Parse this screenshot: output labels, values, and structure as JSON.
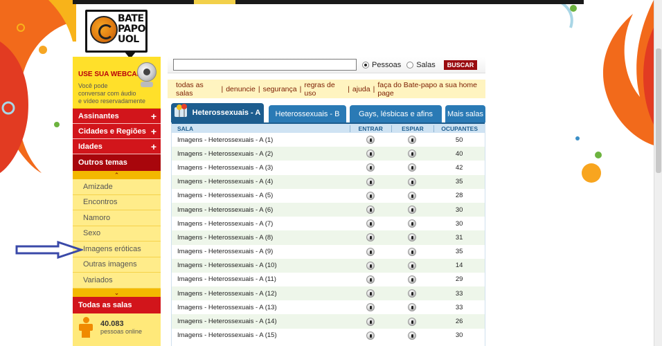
{
  "logo": {
    "line1": "BATE",
    "line2": "PAPO",
    "line3": "UOL"
  },
  "sidebar": {
    "webcam": {
      "title": "USE SUA WEBCAM!",
      "desc1": "Você pode",
      "desc2": "conversar com áudio",
      "desc3": "e vídeo reservadamente"
    },
    "sections": [
      {
        "label": "Assinantes",
        "expand": "+"
      },
      {
        "label": "Cidades e Regiões",
        "expand": "+"
      },
      {
        "label": "Idades",
        "expand": "+"
      }
    ],
    "outros_label": "Outros temas",
    "collapse_glyph": "⌃",
    "expand_glyph": "⌄",
    "subitems": [
      "Amizade",
      "Encontros",
      "Namoro",
      "Sexo",
      "Imagens eróticas",
      "Outras imagens",
      "Variados"
    ],
    "todas_label": "Todas as salas",
    "online_count": "40.083",
    "online_label": "pessoas online"
  },
  "search": {
    "placeholder": "",
    "option_pessoas": "Pessoas",
    "option_salas": "Salas",
    "selected": "Pessoas",
    "button": "BUSCAR"
  },
  "links": [
    "todas as salas",
    "denuncie",
    "segurança",
    "regras de uso",
    "ajuda",
    "faça do Bate-papo a sua home page"
  ],
  "links_separator": "|",
  "tabs": [
    "Heterossexuais - A",
    "Heterossexuais - B",
    "Gays, lésbicas e afins",
    "Mais salas"
  ],
  "table": {
    "headers": {
      "sala": "SALA",
      "entrar": "ENTRAR",
      "espiar": "ESPIAR",
      "ocupantes": "OCUPANTES"
    },
    "rows": [
      {
        "sala": "Imagens - Heterossexuais - A (1)",
        "ocupantes": "50"
      },
      {
        "sala": "Imagens - Heterossexuais - A (2)",
        "ocupantes": "40"
      },
      {
        "sala": "Imagens - Heterossexuais - A (3)",
        "ocupantes": "42"
      },
      {
        "sala": "Imagens - Heterossexuais - A (4)",
        "ocupantes": "35"
      },
      {
        "sala": "Imagens - Heterossexuais - A (5)",
        "ocupantes": "28"
      },
      {
        "sala": "Imagens - Heterossexuais - A (6)",
        "ocupantes": "30"
      },
      {
        "sala": "Imagens - Heterossexuais - A (7)",
        "ocupantes": "30"
      },
      {
        "sala": "Imagens - Heterossexuais - A (8)",
        "ocupantes": "31"
      },
      {
        "sala": "Imagens - Heterossexuais - A (9)",
        "ocupantes": "35"
      },
      {
        "sala": "Imagens - Heterossexuais - A (10)",
        "ocupantes": "14"
      },
      {
        "sala": "Imagens - Heterossexuais - A (11)",
        "ocupantes": "29"
      },
      {
        "sala": "Imagens - Heterossexuais - A (12)",
        "ocupantes": "33"
      },
      {
        "sala": "Imagens - Heterossexuais - A (13)",
        "ocupantes": "33"
      },
      {
        "sala": "Imagens - Heterossexuais - A (14)",
        "ocupantes": "26"
      },
      {
        "sala": "Imagens - Heterossexuais - A (15)",
        "ocupantes": "30"
      }
    ]
  },
  "colors": {
    "brand_red": "#d2151b",
    "tab_blue": "#2a7ab5",
    "sidebar_yellow": "#ffe97a",
    "annotation_arrow": "#3a49a8"
  },
  "annotation": {
    "arrow_icon": "right-arrow-icon",
    "points_to": "Imagens eróticas"
  }
}
